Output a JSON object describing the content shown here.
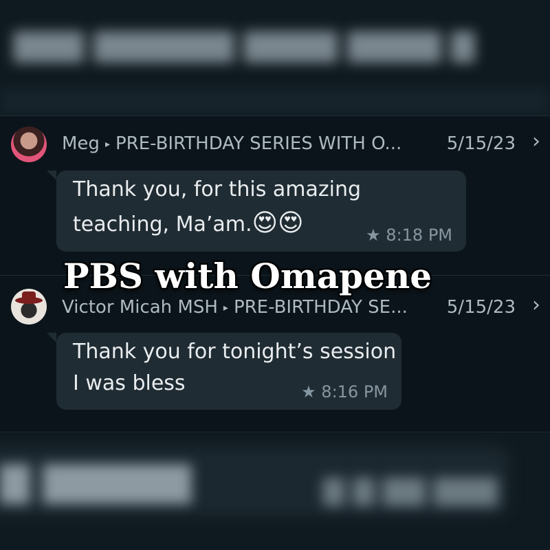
{
  "overlay": {
    "title": "PBS with Omapene"
  },
  "messages": [
    {
      "sender": "Meg",
      "chat": "PRE-BIRTHDAY SERIES WITH O...",
      "date": "5/15/23",
      "lines": [
        "Thank you, for this amazing",
        "teaching, Ma’am."
      ],
      "emoji": "😍😍",
      "time": "8:18 PM",
      "starred": true
    },
    {
      "sender": "Victor Micah MSH",
      "chat": "PRE-BIRTHDAY SE...",
      "date": "5/15/23",
      "lines": [
        "Thank you for tonight’s session",
        "I was bless"
      ],
      "time": "8:16 PM",
      "starred": true
    }
  ],
  "icons": {
    "star": "★",
    "chevron": "›",
    "separator": "▸"
  },
  "colors": {
    "background": "#0b141a",
    "bubble": "#202c33",
    "meta": "#8696a0"
  }
}
